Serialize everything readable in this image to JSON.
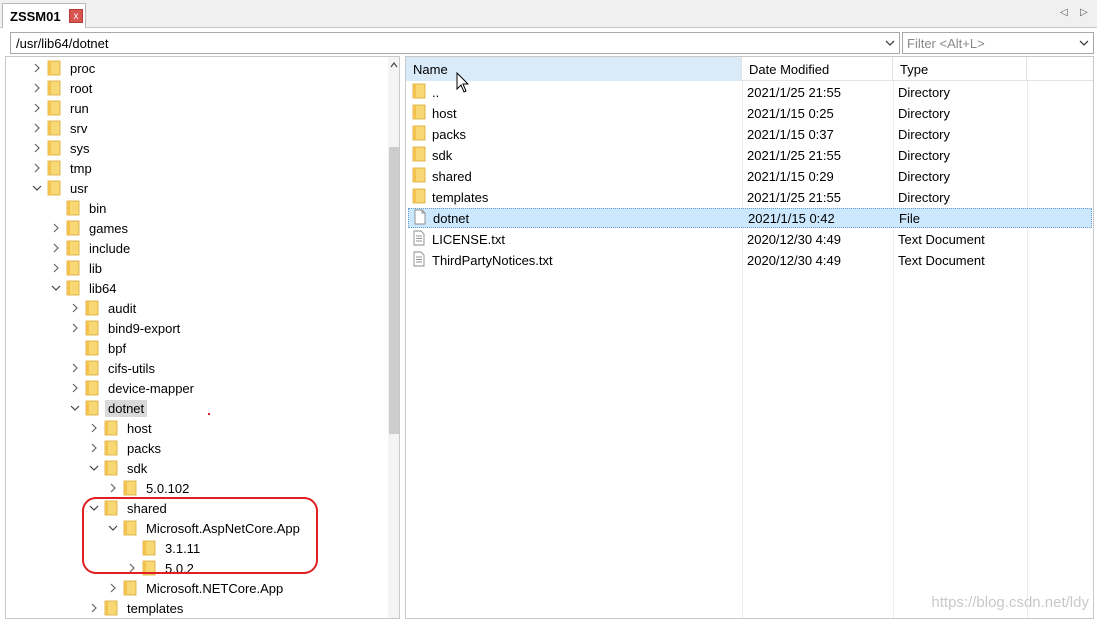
{
  "tab": {
    "title": "ZSSM01",
    "close": "x"
  },
  "path": {
    "value": "/usr/lib64/dotnet"
  },
  "filter": {
    "placeholder": "Filter <Alt+L>"
  },
  "tree": [
    {
      "label": "proc",
      "depth": 0,
      "chevron": "right",
      "selected": false
    },
    {
      "label": "root",
      "depth": 0,
      "chevron": "right",
      "selected": false
    },
    {
      "label": "run",
      "depth": 0,
      "chevron": "right",
      "selected": false
    },
    {
      "label": "srv",
      "depth": 0,
      "chevron": "right",
      "selected": false
    },
    {
      "label": "sys",
      "depth": 0,
      "chevron": "right",
      "selected": false
    },
    {
      "label": "tmp",
      "depth": 0,
      "chevron": "right",
      "selected": false
    },
    {
      "label": "usr",
      "depth": 0,
      "chevron": "down",
      "selected": false
    },
    {
      "label": "bin",
      "depth": 1,
      "chevron": "none",
      "selected": false
    },
    {
      "label": "games",
      "depth": 1,
      "chevron": "right",
      "selected": false
    },
    {
      "label": "include",
      "depth": 1,
      "chevron": "right",
      "selected": false
    },
    {
      "label": "lib",
      "depth": 1,
      "chevron": "right",
      "selected": false
    },
    {
      "label": "lib64",
      "depth": 1,
      "chevron": "down",
      "selected": false
    },
    {
      "label": "audit",
      "depth": 2,
      "chevron": "right",
      "selected": false
    },
    {
      "label": "bind9-export",
      "depth": 2,
      "chevron": "right",
      "selected": false
    },
    {
      "label": "bpf",
      "depth": 2,
      "chevron": "none",
      "selected": false
    },
    {
      "label": "cifs-utils",
      "depth": 2,
      "chevron": "right",
      "selected": false
    },
    {
      "label": "device-mapper",
      "depth": 2,
      "chevron": "right",
      "selected": false
    },
    {
      "label": "dotnet",
      "depth": 2,
      "chevron": "down",
      "selected": true
    },
    {
      "label": "host",
      "depth": 3,
      "chevron": "right",
      "selected": false
    },
    {
      "label": "packs",
      "depth": 3,
      "chevron": "right",
      "selected": false
    },
    {
      "label": "sdk",
      "depth": 3,
      "chevron": "down",
      "selected": false
    },
    {
      "label": "5.0.102",
      "depth": 4,
      "chevron": "right",
      "selected": false
    },
    {
      "label": "shared",
      "depth": 3,
      "chevron": "down",
      "selected": false
    },
    {
      "label": "Microsoft.AspNetCore.App",
      "depth": 4,
      "chevron": "down",
      "selected": false
    },
    {
      "label": "3.1.11",
      "depth": 5,
      "chevron": "none",
      "selected": false
    },
    {
      "label": "5.0.2",
      "depth": 5,
      "chevron": "right",
      "selected": false
    },
    {
      "label": "Microsoft.NETCore.App",
      "depth": 4,
      "chevron": "right",
      "selected": false
    },
    {
      "label": "templates",
      "depth": 3,
      "chevron": "right",
      "selected": false
    }
  ],
  "list": {
    "columns": {
      "name": "Name",
      "date": "Date Modified",
      "type": "Type"
    },
    "rows": [
      {
        "name": "..",
        "date": "2021/1/25 21:55",
        "type": "Directory",
        "icon": "folder",
        "selected": false
      },
      {
        "name": "host",
        "date": "2021/1/15 0:25",
        "type": "Directory",
        "icon": "folder",
        "selected": false
      },
      {
        "name": "packs",
        "date": "2021/1/15 0:37",
        "type": "Directory",
        "icon": "folder",
        "selected": false
      },
      {
        "name": "sdk",
        "date": "2021/1/25 21:55",
        "type": "Directory",
        "icon": "folder",
        "selected": false
      },
      {
        "name": "shared",
        "date": "2021/1/15 0:29",
        "type": "Directory",
        "icon": "folder",
        "selected": false
      },
      {
        "name": "templates",
        "date": "2021/1/25 21:55",
        "type": "Directory",
        "icon": "folder",
        "selected": false
      },
      {
        "name": "dotnet",
        "date": "2021/1/15 0:42",
        "type": "File",
        "icon": "file",
        "selected": true
      },
      {
        "name": "LICENSE.txt",
        "date": "2020/12/30 4:49",
        "type": "Text Document",
        "icon": "text-file",
        "selected": false
      },
      {
        "name": "ThirdPartyNotices.txt",
        "date": "2020/12/30 4:49",
        "type": "Text Document",
        "icon": "text-file",
        "selected": false
      }
    ]
  },
  "watermark": "https://blog.csdn.net/ldy",
  "colors": {
    "folder": "#f8d775",
    "folder_edge": "#d9a92e",
    "selection": "#cce8ff",
    "annotation": "#e02020"
  }
}
